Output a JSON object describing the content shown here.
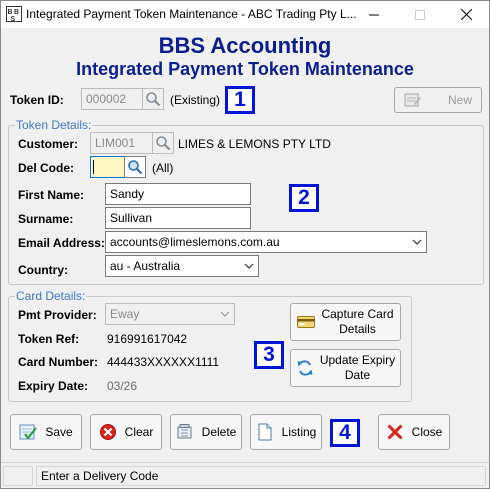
{
  "window": {
    "title": "Integrated Payment Token Maintenance - ABC Trading Pty L..."
  },
  "header": {
    "line1": "BBS Accounting",
    "line2": "Integrated Payment Token Maintenance"
  },
  "token": {
    "id_label": "Token ID:",
    "id_value": "000002",
    "status": "(Existing)",
    "new_button": "New"
  },
  "token_details": {
    "group_title": "Token Details:",
    "customer_label": "Customer:",
    "customer_code": "LIM001",
    "customer_name": "LIMES & LEMONS PTY LTD",
    "del_code_label": "Del Code:",
    "del_code_value": "",
    "del_code_hint": "(All)",
    "first_name_label": "First Name:",
    "first_name_value": "Sandy",
    "surname_label": "Surname:",
    "surname_value": "Sullivan",
    "email_label": "Email Address:",
    "email_value": "accounts@limeslemons.com.au",
    "country_label": "Country:",
    "country_value": "au - Australia"
  },
  "card_details": {
    "group_title": "Card Details:",
    "provider_label": "Pmt Provider:",
    "provider_value": "Eway",
    "token_ref_label": "Token Ref:",
    "token_ref_value": "916991617042",
    "card_number_label": "Card Number:",
    "card_number_value": "444433XXXXXX1111",
    "expiry_label": "Expiry Date:",
    "expiry_value": "03/26",
    "capture_button": [
      "Capture Card",
      "Details"
    ],
    "update_button": [
      "Update Expiry",
      "Date"
    ]
  },
  "callouts": [
    "1",
    "2",
    "3",
    "4"
  ],
  "actions": {
    "save": "Save",
    "clear": "Clear",
    "delete": "Delete",
    "listing": "Listing",
    "close": "Close"
  },
  "status": {
    "message": "Enter a Delivery Code"
  },
  "colors": {
    "heading": "#0a1f8f",
    "callout": "#0015d6",
    "group_title": "#3c78c8"
  }
}
